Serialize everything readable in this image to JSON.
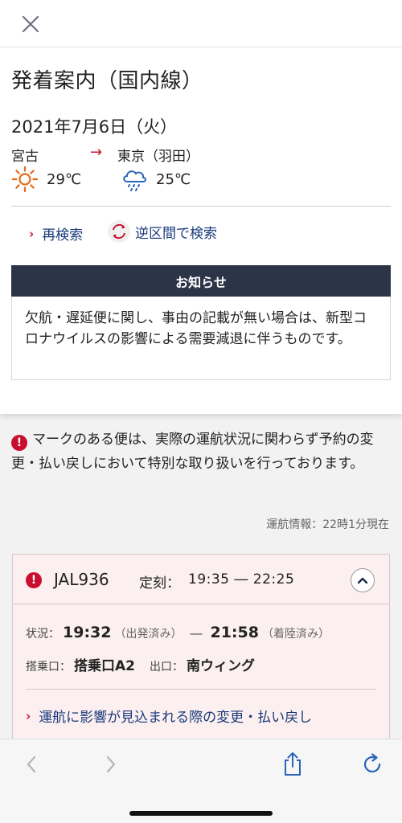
{
  "header": {
    "close_icon": "close-icon"
  },
  "page": {
    "title": "発着案内（国内線）",
    "date": "2021年7月6日（火）"
  },
  "route": {
    "from": "宮古",
    "to": "東京（羽田）",
    "from_temp": "29℃",
    "to_temp": "25℃",
    "from_weather_icon": "sun-icon",
    "to_weather_icon": "rain-cloud-icon"
  },
  "links": {
    "research": "再検索",
    "reverse": "逆区間で検索"
  },
  "notice": {
    "heading": "お知らせ",
    "body": "欠航・遅延便に関し、事由の記載が無い場合は、新型コロナウイルスの影響による需要減退に伴うものです。"
  },
  "mark_note": "マークのある便は、実際の運航状況に関わらず予約の変更・払い戻しにおいて特別な取り扱いを行っております。",
  "op_info": "運航情報：22時1分現在",
  "flight": {
    "number": "JAL936",
    "sched_label": "定刻：",
    "sched_time": "19:35 ― 22:25",
    "status_label": "状況：",
    "dep_time": "19:32",
    "dep_status": "（出発済み）",
    "arr_time": "21:58",
    "arr_status": "（着陸済み）",
    "gate_label": "搭乗口：",
    "gate_value": "搭乗口A2",
    "exit_label": "出口：",
    "exit_value": "南ウィング",
    "link": "運航に影響が見込まれる際の変更・払い戻し"
  },
  "colors": {
    "accent_red": "#c8102e",
    "link_blue": "#1a3a7a",
    "notice_header": "#2c3548",
    "card_bg": "#fbeff0"
  }
}
